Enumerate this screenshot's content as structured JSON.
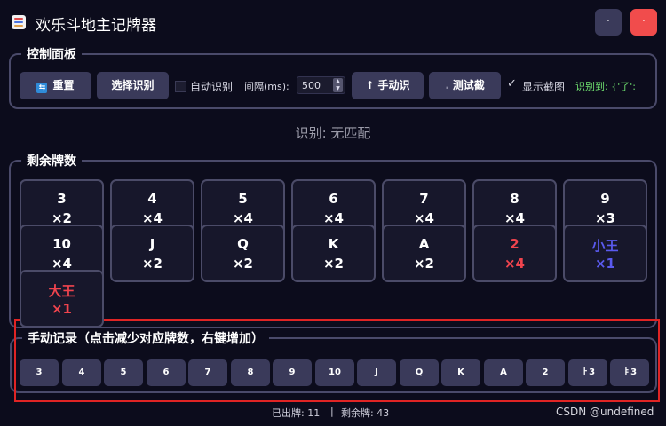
{
  "window": {
    "title": "欢乐斗地主记牌器",
    "icon": "app-icon",
    "min_label": "·",
    "close_label": "·",
    "accent_close": "#f14c4c"
  },
  "control_panel": {
    "title": "控制面板",
    "reset_label": "重置",
    "reset_icon": "refresh-icon",
    "select_label": "选择识别",
    "auto_label": "自动识别",
    "auto_checked": false,
    "interval_label": "间隔(ms):",
    "interval_value": "500",
    "manual_label": "手动识",
    "manual_icon": "arrow-up-icon",
    "test_label": "测试截",
    "show_label": "显示截图",
    "show_checked": true,
    "recognized_label": "识别到: {'了':",
    "recognized_color": "#6fe06f"
  },
  "status": {
    "text": "识别: 无匹配"
  },
  "remaining": {
    "title": "剩余牌数",
    "cards": [
      {
        "name": "3",
        "count": "×2",
        "color": "#ffffff"
      },
      {
        "name": "4",
        "count": "×4",
        "color": "#ffffff"
      },
      {
        "name": "5",
        "count": "×4",
        "color": "#ffffff"
      },
      {
        "name": "6",
        "count": "×4",
        "color": "#ffffff"
      },
      {
        "name": "7",
        "count": "×4",
        "color": "#ffffff"
      },
      {
        "name": "8",
        "count": "×4",
        "color": "#ffffff"
      },
      {
        "name": "9",
        "count": "×3",
        "color": "#ffffff"
      },
      {
        "name": "10",
        "count": "×4",
        "color": "#ffffff"
      },
      {
        "name": "J",
        "count": "×2",
        "color": "#ffffff"
      },
      {
        "name": "Q",
        "count": "×2",
        "color": "#ffffff"
      },
      {
        "name": "K",
        "count": "×2",
        "color": "#ffffff"
      },
      {
        "name": "A",
        "count": "×2",
        "color": "#ffffff"
      },
      {
        "name": "2",
        "count": "×4",
        "color": "#f0444e"
      },
      {
        "name": "小王",
        "count": "×1",
        "color": "#5a5aee"
      },
      {
        "name": "大王",
        "count": "×1",
        "color": "#f0444e"
      }
    ]
  },
  "manual": {
    "title": "手动记录（点击减少对应牌数，右键增加）",
    "buttons": [
      "3",
      "4",
      "5",
      "6",
      "7",
      "8",
      "9",
      "10",
      "J",
      "Q",
      "K",
      "A",
      "2",
      "ㅏ3",
      "ㅑ3"
    ]
  },
  "footer": {
    "played": "已出牌: 11",
    "separator": "|",
    "remaining": "剩余牌: 43",
    "watermark": "CSDN @undefined"
  }
}
